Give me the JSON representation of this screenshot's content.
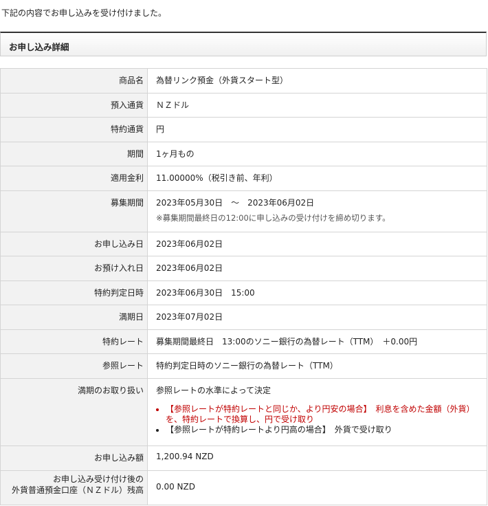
{
  "intro_text": "下記の内容でお申し込みを受け付けました。",
  "section_title": "お申し込み詳細",
  "rows": {
    "product": {
      "label": "商品名",
      "value": "為替リンク預金（外貨スタート型）"
    },
    "deposit_currency": {
      "label": "預入通貨",
      "value": "ＮＺドル"
    },
    "special_currency": {
      "label": "特約通貨",
      "value": "円"
    },
    "term": {
      "label": "期間",
      "value": "1ヶ月もの"
    },
    "rate": {
      "label": "適用金利",
      "value": "11.00000%（税引き前、年利）"
    },
    "offer_period": {
      "label": "募集期間",
      "value": "2023年05月30日　～　2023年06月02日",
      "note": "※募集期間最終日の12:00に申し込みの受け付けを締め切ります。"
    },
    "application_date": {
      "label": "お申し込み日",
      "value": "2023年06月02日"
    },
    "deposit_date": {
      "label": "お預け入れ日",
      "value": "2023年06月02日"
    },
    "judgment_datetime": {
      "label": "特約判定日時",
      "value": "2023年06月30日　15:00"
    },
    "maturity_date": {
      "label": "満期日",
      "value": "2023年07月02日"
    },
    "special_rate": {
      "label": "特約レート",
      "value": "募集期間最終日　13:00のソニー銀行の為替レート（TTM）　＋0.00円"
    },
    "reference_rate": {
      "label": "参照レート",
      "value": "特約判定日時のソニー銀行の為替レート（TTM）"
    },
    "maturity_handling": {
      "label": "満期のお取り扱い",
      "value": "参照レートの水準によって決定",
      "options": [
        "【参照レートが特約レートと同じか、より円安の場合】　利息を含めた金額（外貨）を、特約レートで換算し、円で受け取り",
        "【参照レートが特約レートより円高の場合】　外貨で受け取り"
      ]
    },
    "application_amount": {
      "label": "お申し込み額",
      "value": "1,200.94 NZD"
    },
    "remaining_balance": {
      "label_line1": "お申し込み受け付け後の",
      "label_line2": "外貨普通預金口座（ＮＺドル）残高",
      "value": "0.00 NZD"
    }
  }
}
